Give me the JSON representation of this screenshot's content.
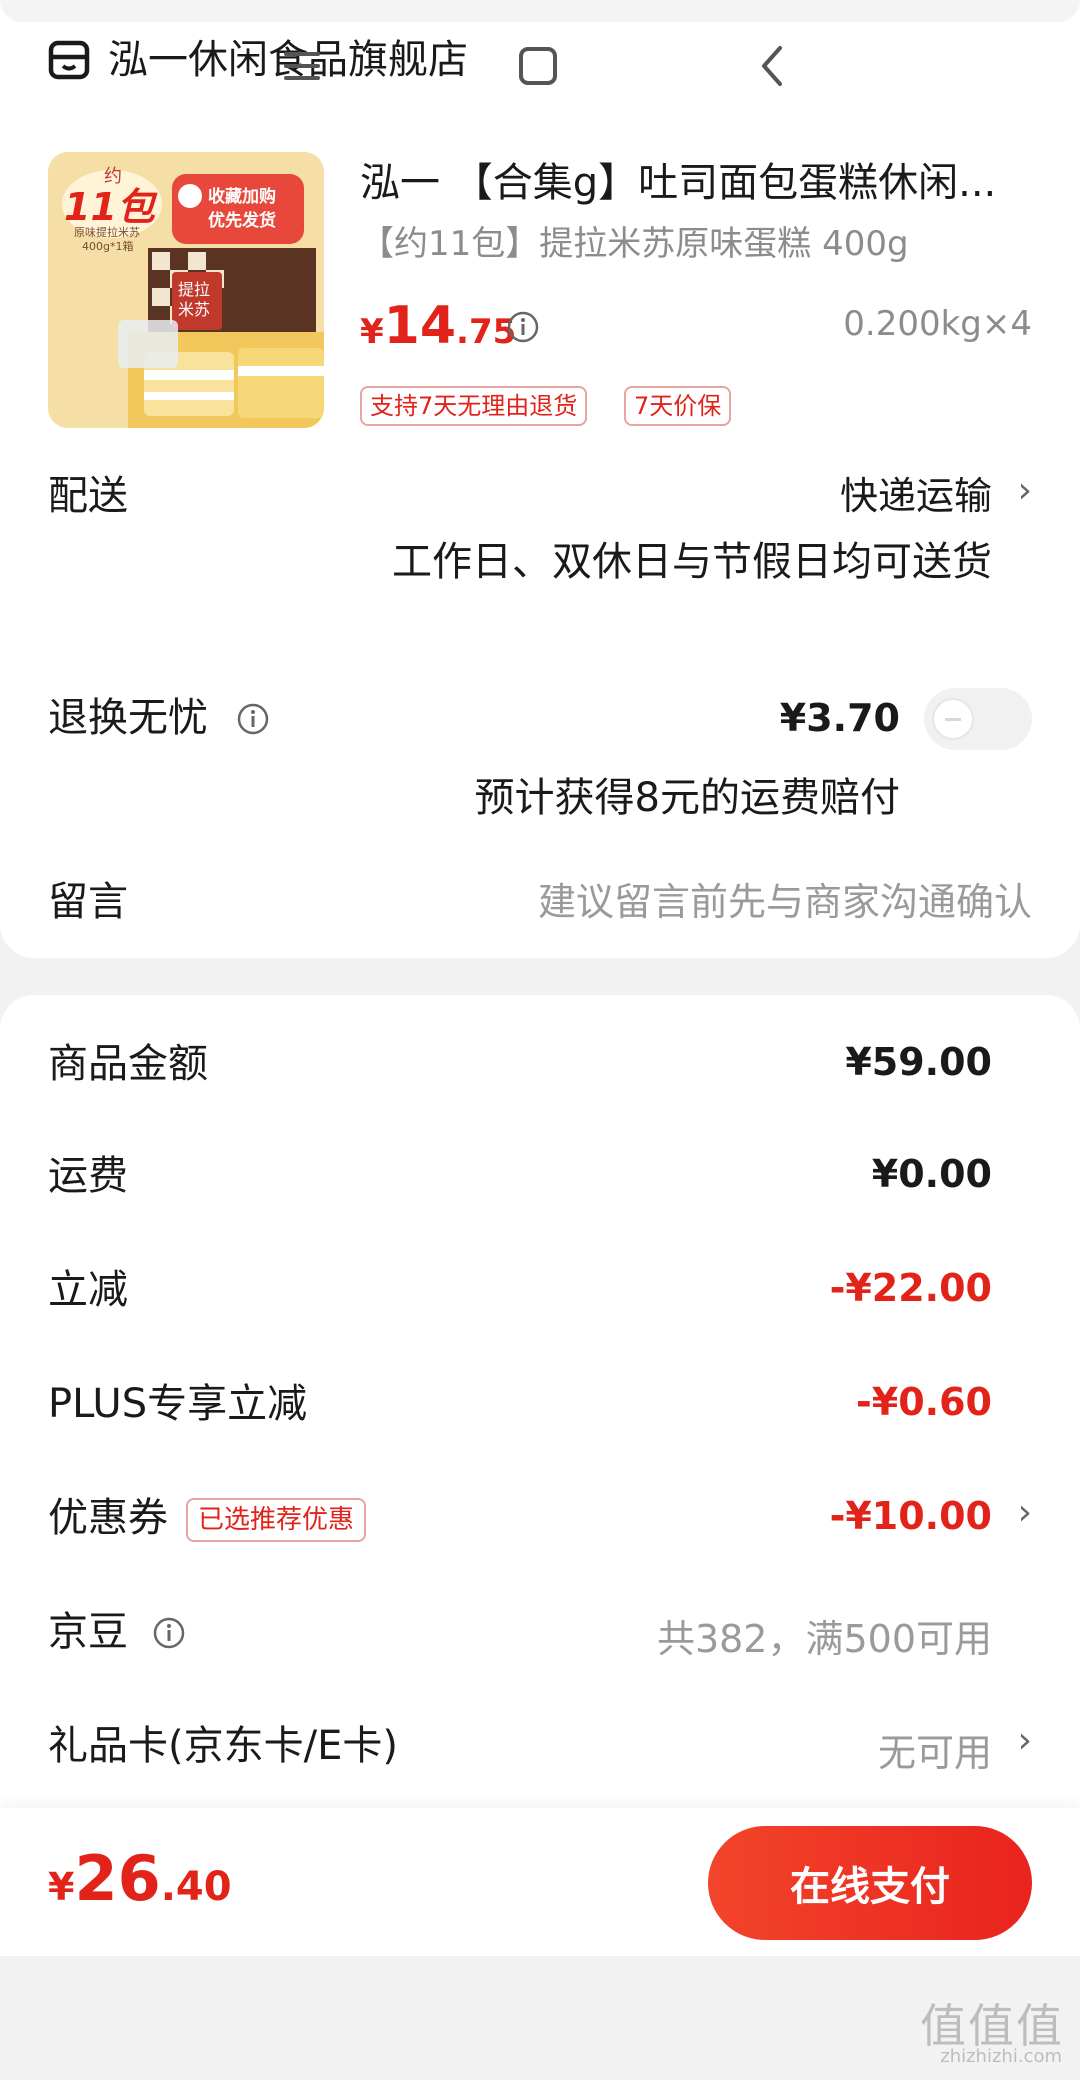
{
  "store": {
    "name": "泓一休闲食品旗舰店",
    "icon": "store-icon"
  },
  "product": {
    "title": "泓一 【合集g】吐司面包蛋糕休闲...",
    "spec": "【约11包】提拉米苏原味蛋糕 400g",
    "price_currency": "¥",
    "price_int": "14",
    "price_dec": ".75",
    "quantity": "0.200kg×4",
    "tags": [
      "支持7天无理由退货",
      "7天价保"
    ],
    "image_text": {
      "badge_top": "约",
      "badge_num": "11包",
      "badge_sub": "原味提拉米苏",
      "badge_sub2": "400g*1箱",
      "banner": "收藏加购",
      "banner2": "优先发货",
      "box_text": "提拉米苏"
    }
  },
  "delivery": {
    "label": "配送",
    "value": "快递运输",
    "note": "工作日、双休日与节假日均可送货"
  },
  "return_service": {
    "label": "退换无忧",
    "price": "¥3.70",
    "enabled": false,
    "note": "预计获得8元的运费赔付"
  },
  "message": {
    "label": "留言",
    "placeholder": "建议留言前先与商家沟通确认"
  },
  "fees": {
    "goods": {
      "label": "商品金额",
      "value": "¥59.00"
    },
    "shipping": {
      "label": "运费",
      "value": "¥0.00"
    },
    "discount": {
      "label": "立减",
      "value": "-¥22.00"
    },
    "plus": {
      "label": "PLUS专享立减",
      "value": "-¥0.60"
    },
    "coupon": {
      "label": "优惠券",
      "badge": "已选推荐优惠",
      "value": "-¥10.00"
    },
    "jingdou": {
      "label": "京豆",
      "value": "共382，满500可用"
    },
    "giftcard": {
      "label": "礼品卡(京东卡/E卡)",
      "value": "无可用"
    }
  },
  "total": {
    "currency": "¥",
    "int": "26",
    "dec": ".40"
  },
  "pay_button": "在线支付",
  "watermark": {
    "main": "值值值",
    "sub": "zhizhizhi.com"
  },
  "colors": {
    "accent": "#e2231a",
    "muted": "#9a9a9a"
  }
}
